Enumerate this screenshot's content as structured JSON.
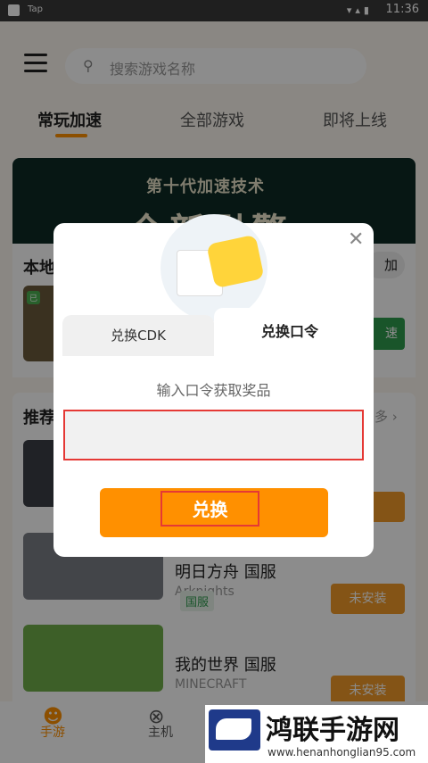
{
  "status_bar": {
    "left_label": "Tap",
    "time": "11:36"
  },
  "header": {
    "search_placeholder": "搜索游戏名称"
  },
  "tabs": [
    "常玩加速",
    "全部游戏",
    "即将上线"
  ],
  "banner": {
    "line1": "第十代加速技术",
    "line2": "全新引擎"
  },
  "local": {
    "title": "本地",
    "add_label": "加",
    "action_label": "速",
    "badge": "已"
  },
  "recommend": {
    "title": "推荐",
    "more": "多 ›"
  },
  "games": [
    {
      "name": "",
      "sub": "",
      "button": "装"
    },
    {
      "name": "明日方舟 国服",
      "sub": "Arknights",
      "tag": "国服",
      "button": "未安装"
    },
    {
      "name": "我的世界 国服",
      "sub": "MINECRAFT",
      "button": "未安装"
    }
  ],
  "bottom_nav": [
    {
      "label": "手游",
      "icon": "game-face-icon",
      "active_color": "#ff9000"
    },
    {
      "label": "主机",
      "icon": "gamepad-icon"
    }
  ],
  "modal": {
    "tabs": [
      "兑换CDK",
      "兑换口令"
    ],
    "active_tab": 1,
    "prompt": "输入口令获取奖品",
    "input_value": "",
    "redeem_label": "兑换",
    "close_glyph": "✕"
  },
  "watermark": {
    "title": "鸿联手游网",
    "url": "www.henanhonglian95.com"
  },
  "colors": {
    "accent": "#ff9000",
    "install": "#f09a28",
    "green": "#2e9b4e",
    "highlight_border": "#e53935"
  }
}
